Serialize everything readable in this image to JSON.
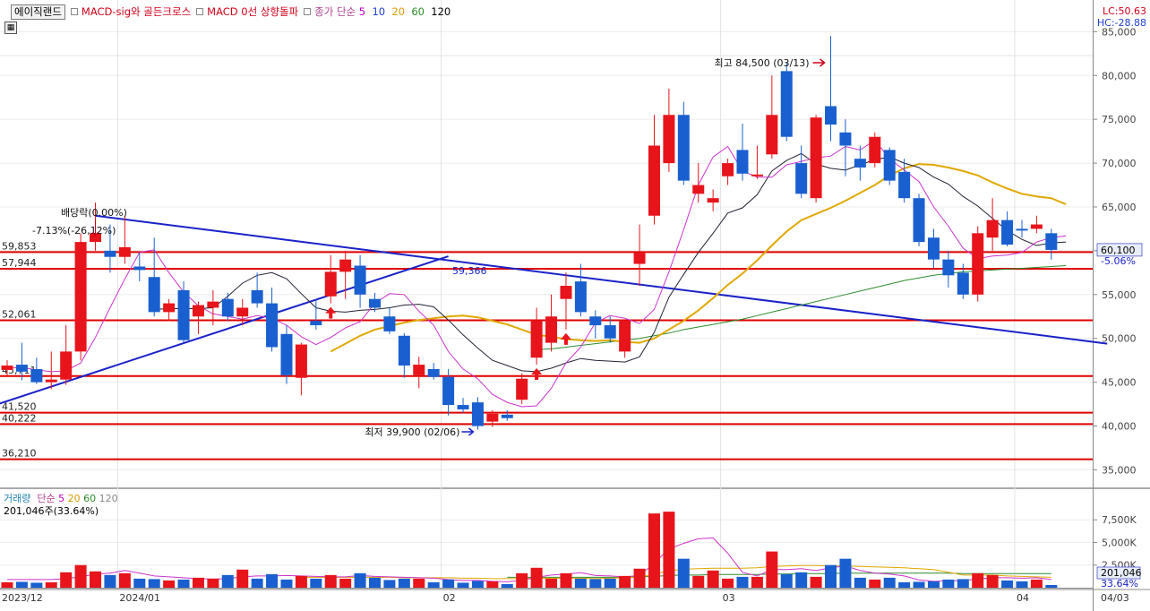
{
  "header": {
    "stock_name": "에이직랜드",
    "ind1": "MACD-sig와 골든크로스",
    "ind2": "MACD 0선 상향돌파",
    "ma_label": "종가 단순",
    "ma_periods": [
      "5",
      "10",
      "20",
      "60",
      "120"
    ],
    "lc": "LC:50.63",
    "hc": "HC:-28.88"
  },
  "volume_header": {
    "label": "거래량",
    "ma_label": "단순",
    "ma_periods": [
      "5",
      "20",
      "60",
      "120"
    ],
    "value_text": "201,046주(33.64%)"
  },
  "colors": {
    "up": "#e8141b",
    "down": "#1a5fd0",
    "ma5": "#cc33cc",
    "ma10": "#222233",
    "ma20": "#e0a800",
    "ma60": "#2e8b2e",
    "hline": "#e00000",
    "trend": "#1a22c8"
  },
  "chart_data": {
    "type": "candlestick",
    "y_axis": {
      "ylim": [
        33000,
        88000
      ],
      "ticks": [
        "85,000",
        "80,000",
        "75,000",
        "70,000",
        "65,000",
        "60,000",
        "55,000",
        "50,000",
        "45,000",
        "40,000",
        "35,000"
      ],
      "tick_values": [
        85000,
        80000,
        75000,
        70000,
        65000,
        60000,
        55000,
        50000,
        45000,
        40000,
        35000
      ]
    },
    "x_axis": {
      "labels": [
        {
          "text": "2023/12",
          "index": 0
        },
        {
          "text": "2024/01",
          "index": 8
        },
        {
          "text": "02",
          "index": 30
        },
        {
          "text": "03",
          "index": 49
        },
        {
          "text": "04",
          "index": 69
        },
        {
          "text": "04/03",
          "index": 74
        }
      ]
    },
    "candles": [
      {
        "o": 46400,
        "h": 47500,
        "l": 45600,
        "c": 46900
      },
      {
        "o": 47000,
        "h": 49500,
        "l": 45200,
        "c": 46200
      },
      {
        "o": 46500,
        "h": 47800,
        "l": 44800,
        "c": 45000
      },
      {
        "o": 45000,
        "h": 48500,
        "l": 44200,
        "c": 45300
      },
      {
        "o": 45300,
        "h": 51500,
        "l": 44700,
        "c": 48500
      },
      {
        "o": 48500,
        "h": 62000,
        "l": 47500,
        "c": 61000
      },
      {
        "o": 61000,
        "h": 65500,
        "l": 60000,
        "c": 62000
      },
      {
        "o": 60000,
        "h": 63000,
        "l": 57500,
        "c": 59300
      },
      {
        "o": 59300,
        "h": 64000,
        "l": 58500,
        "c": 60400
      },
      {
        "o": 58200,
        "h": 59800,
        "l": 56500,
        "c": 57800
      },
      {
        "o": 57000,
        "h": 61500,
        "l": 52500,
        "c": 53000
      },
      {
        "o": 53000,
        "h": 54500,
        "l": 52000,
        "c": 54000
      },
      {
        "o": 55500,
        "h": 56500,
        "l": 49500,
        "c": 49800
      },
      {
        "o": 52500,
        "h": 54200,
        "l": 50500,
        "c": 53800
      },
      {
        "o": 53500,
        "h": 55500,
        "l": 51500,
        "c": 54200
      },
      {
        "o": 54500,
        "h": 55200,
        "l": 52000,
        "c": 52500
      },
      {
        "o": 52500,
        "h": 54500,
        "l": 51500,
        "c": 53500
      },
      {
        "o": 55500,
        "h": 57500,
        "l": 53500,
        "c": 54000
      },
      {
        "o": 54000,
        "h": 55800,
        "l": 48500,
        "c": 49000
      },
      {
        "o": 50500,
        "h": 51500,
        "l": 44800,
        "c": 45800
      },
      {
        "o": 45500,
        "h": 49500,
        "l": 43500,
        "c": 49300
      },
      {
        "o": 52000,
        "h": 54500,
        "l": 51000,
        "c": 51500
      },
      {
        "o": 54800,
        "h": 59500,
        "l": 54000,
        "c": 57600
      },
      {
        "o": 57600,
        "h": 60000,
        "l": 54500,
        "c": 59000
      },
      {
        "o": 58300,
        "h": 59500,
        "l": 53500,
        "c": 55000
      },
      {
        "o": 54500,
        "h": 55200,
        "l": 53000,
        "c": 53500
      },
      {
        "o": 52500,
        "h": 53500,
        "l": 50500,
        "c": 50800
      },
      {
        "o": 50300,
        "h": 50600,
        "l": 45500,
        "c": 46900
      },
      {
        "o": 45800,
        "h": 47900,
        "l": 44300,
        "c": 47000
      },
      {
        "o": 46500,
        "h": 47200,
        "l": 45300,
        "c": 45600
      },
      {
        "o": 45600,
        "h": 46500,
        "l": 41200,
        "c": 42400
      },
      {
        "o": 42400,
        "h": 43200,
        "l": 41500,
        "c": 41900
      },
      {
        "o": 42700,
        "h": 43300,
        "l": 39600,
        "c": 40000
      },
      {
        "o": 40500,
        "h": 41800,
        "l": 39900,
        "c": 41400
      },
      {
        "o": 41300,
        "h": 41800,
        "l": 40600,
        "c": 40900
      },
      {
        "o": 43000,
        "h": 46000,
        "l": 42500,
        "c": 45400
      },
      {
        "o": 47800,
        "h": 53500,
        "l": 47000,
        "c": 52000
      },
      {
        "o": 49500,
        "h": 55000,
        "l": 48500,
        "c": 52500
      },
      {
        "o": 54500,
        "h": 57500,
        "l": 51000,
        "c": 56000
      },
      {
        "o": 56500,
        "h": 58500,
        "l": 52500,
        "c": 53000
      },
      {
        "o": 52500,
        "h": 53200,
        "l": 50000,
        "c": 51500
      },
      {
        "o": 51500,
        "h": 52500,
        "l": 49500,
        "c": 50000
      },
      {
        "o": 48500,
        "h": 52000,
        "l": 47800,
        "c": 52000
      },
      {
        "o": 58500,
        "h": 63000,
        "l": 56000,
        "c": 59800
      },
      {
        "o": 64000,
        "h": 75500,
        "l": 63000,
        "c": 72000
      },
      {
        "o": 70000,
        "h": 78500,
        "l": 69000,
        "c": 75500
      },
      {
        "o": 75500,
        "h": 77000,
        "l": 67500,
        "c": 68000
      },
      {
        "o": 66500,
        "h": 70000,
        "l": 65500,
        "c": 67500
      },
      {
        "o": 65500,
        "h": 67000,
        "l": 64500,
        "c": 66000
      },
      {
        "o": 68500,
        "h": 70500,
        "l": 67500,
        "c": 70000
      },
      {
        "o": 71500,
        "h": 74500,
        "l": 68000,
        "c": 68800
      },
      {
        "o": 68500,
        "h": 72000,
        "l": 68200,
        "c": 68700
      },
      {
        "o": 71000,
        "h": 80000,
        "l": 70500,
        "c": 75500
      },
      {
        "o": 80500,
        "h": 81500,
        "l": 72500,
        "c": 73000
      },
      {
        "o": 70000,
        "h": 72000,
        "l": 66000,
        "c": 66500
      },
      {
        "o": 66000,
        "h": 75500,
        "l": 65500,
        "c": 75200
      },
      {
        "o": 76500,
        "h": 84500,
        "l": 72500,
        "c": 74400
      },
      {
        "o": 73500,
        "h": 75000,
        "l": 68500,
        "c": 72000
      },
      {
        "o": 70500,
        "h": 72000,
        "l": 68000,
        "c": 69500
      },
      {
        "o": 70000,
        "h": 73500,
        "l": 69500,
        "c": 73000
      },
      {
        "o": 71500,
        "h": 71800,
        "l": 67500,
        "c": 68000
      },
      {
        "o": 69000,
        "h": 70500,
        "l": 65500,
        "c": 66000
      },
      {
        "o": 66000,
        "h": 66500,
        "l": 60500,
        "c": 61000
      },
      {
        "o": 61500,
        "h": 62500,
        "l": 58000,
        "c": 59000
      },
      {
        "o": 59000,
        "h": 60000,
        "l": 55800,
        "c": 57200
      },
      {
        "o": 57500,
        "h": 58500,
        "l": 54500,
        "c": 55000
      },
      {
        "o": 55000,
        "h": 62800,
        "l": 54200,
        "c": 62000
      },
      {
        "o": 61500,
        "h": 66000,
        "l": 60000,
        "c": 63500
      },
      {
        "o": 63500,
        "h": 64500,
        "l": 60500,
        "c": 60700
      },
      {
        "o": 62500,
        "h": 63500,
        "l": 61500,
        "c": 62300
      },
      {
        "o": 62500,
        "h": 64000,
        "l": 62000,
        "c": 63000
      },
      {
        "o": 62000,
        "h": 62500,
        "l": 59000,
        "c": 60100
      }
    ],
    "ma5": [
      46600,
      46700,
      46400,
      46200,
      46300,
      47200,
      50100,
      53500,
      56800,
      59800,
      60100,
      57500,
      55300,
      53700,
      52800,
      52500,
      52200,
      52600,
      52300,
      51500,
      50200,
      49300,
      50100,
      51200,
      51900,
      54000,
      55100,
      55000,
      53100,
      51500,
      48500,
      46500,
      45400,
      43600,
      42700,
      42200,
      42300,
      44300,
      47200,
      49000,
      51800,
      52600,
      52300,
      51700,
      53300,
      57600,
      62400,
      67500,
      70700,
      71900,
      69100,
      68400,
      68400,
      69800,
      70200,
      70600,
      70800,
      71900,
      71500,
      72600,
      70500,
      69200,
      67900,
      65000,
      62800,
      60300,
      59100,
      59400,
      59500,
      59800,
      61000,
      61500,
      61700
    ],
    "ma10": [
      null,
      null,
      null,
      null,
      null,
      null,
      null,
      null,
      null,
      null,
      53300,
      53400,
      53400,
      53400,
      53500,
      54800,
      56300,
      57200,
      57500,
      56800,
      55100,
      53500,
      53100,
      53000,
      53200,
      53300,
      53500,
      53800,
      53900,
      53600,
      52100,
      50400,
      48900,
      47500,
      46900,
      46300,
      46200,
      46600,
      47200,
      47700,
      47500,
      47400,
      47300,
      47900,
      50700,
      54700,
      57300,
      59800,
      62000,
      64300,
      64900,
      66400,
      69100,
      70300,
      71100,
      69900,
      69400,
      69200,
      69800,
      70400,
      70700,
      70000,
      69500,
      68400,
      67600,
      66200,
      65100,
      63700,
      62300,
      61300,
      60600,
      60900,
      61000
    ],
    "ma20": [
      null,
      null,
      null,
      null,
      null,
      null,
      null,
      null,
      null,
      null,
      null,
      null,
      null,
      null,
      null,
      null,
      null,
      null,
      null,
      null,
      null,
      null,
      48500,
      49400,
      50300,
      51000,
      51400,
      51800,
      52100,
      52300,
      52500,
      52600,
      52400,
      52000,
      51600,
      51000,
      50400,
      50200,
      49900,
      49800,
      49700,
      49800,
      49600,
      49500,
      50000,
      51000,
      52000,
      53200,
      54600,
      56100,
      57400,
      58900,
      60600,
      62200,
      63500,
      64200,
      64900,
      65700,
      66600,
      67500,
      68600,
      69400,
      69900,
      69800,
      69500,
      69100,
      68600,
      67800,
      67100,
      66500,
      66200,
      66000,
      65300
    ],
    "ma60": [
      null,
      null,
      null,
      null,
      null,
      null,
      null,
      null,
      null,
      null,
      null,
      null,
      null,
      null,
      null,
      null,
      null,
      null,
      null,
      null,
      null,
      null,
      null,
      null,
      null,
      null,
      null,
      null,
      null,
      null,
      null,
      null,
      null,
      null,
      null,
      null,
      48700,
      48800,
      49000,
      49200,
      49400,
      49600,
      49800,
      50000,
      50300,
      50600,
      51000,
      51300,
      51600,
      51900,
      52200,
      52600,
      53000,
      53400,
      53800,
      54200,
      54600,
      55000,
      55400,
      55800,
      56200,
      56600,
      56900,
      57200,
      57400,
      57600,
      57700,
      57800,
      57900,
      58000,
      58100,
      58200,
      58300
    ],
    "hlines": [
      {
        "value": 59853,
        "label": "59,853"
      },
      {
        "value": 57944,
        "label": "57,944"
      },
      {
        "value": 52061,
        "label": "52,061"
      },
      {
        "value": 45700,
        "label": "45,711"
      },
      {
        "value": 41520,
        "label": "41,520"
      },
      {
        "value": 40222,
        "label": "40,222"
      },
      {
        "value": 36210,
        "label": "36,210"
      }
    ],
    "trendlines": [
      {
        "from": {
          "index": -1,
          "value": 42300
        },
        "to": {
          "index": 30,
          "value": 59366
        }
      },
      {
        "from": {
          "index": 6,
          "value": 64000
        },
        "to": {
          "index": 74.8,
          "value": 49400
        }
      }
    ],
    "annotations": {
      "dividend": "배당락(0.00%)",
      "dividend_change": "-7.13%(-26,12%)",
      "trend_value": "59,366",
      "high": "최고 84,500 (03/13)",
      "low": "최저 39,900 (02/06)",
      "current_price": "60,100",
      "current_change": "-5.06%"
    },
    "signals": [
      22,
      36,
      38
    ],
    "volume": {
      "ylim": [
        0,
        9500
      ],
      "ticks": [
        "7,500K",
        "5,000K",
        "2,500K"
      ],
      "tick_values": [
        7500,
        5000,
        2500
      ],
      "current_label": "201,046",
      "current_pct": "33.64%",
      "bars": [
        600,
        650,
        550,
        600,
        1700,
        2500,
        1800,
        1400,
        1600,
        1000,
        950,
        800,
        900,
        1100,
        1000,
        1400,
        2000,
        1000,
        1500,
        900,
        1300,
        1000,
        1400,
        1000,
        1600,
        1100,
        850,
        1000,
        1000,
        600,
        900,
        550,
        750,
        700,
        400,
        1600,
        2200,
        1000,
        1600,
        1000,
        950,
        1000,
        1300,
        2100,
        8200,
        8400,
        3200,
        1300,
        1900,
        1000,
        1200,
        1200,
        4000,
        1500,
        1700,
        1200,
        2500,
        3200,
        1100,
        900,
        1100,
        600,
        650,
        700,
        900,
        950,
        1600,
        1400,
        800,
        700,
        900,
        300
      ],
      "ma5": [
        900,
        900,
        900,
        900,
        1000,
        1200,
        1500,
        1600,
        1900,
        1600,
        1300,
        1200,
        1100,
        1000,
        950,
        1000,
        1200,
        1300,
        1300,
        1350,
        1300,
        1250,
        1200,
        1200,
        1350,
        1250,
        1200,
        1150,
        1100,
        1050,
        900,
        800,
        800,
        700,
        650,
        800,
        1150,
        1400,
        1500,
        1650,
        1350,
        1300,
        1200,
        1350,
        2700,
        4300,
        4900,
        5400,
        5500,
        3800,
        1700,
        1300,
        2000,
        2000,
        2100,
        1900,
        2200,
        2400,
        1900,
        1600,
        1500,
        1300,
        850,
        700,
        750,
        800,
        950,
        1100,
        1100,
        1050,
        1100,
        900
      ],
      "ma20": [
        null,
        null,
        null,
        null,
        null,
        null,
        null,
        null,
        null,
        null,
        null,
        null,
        null,
        null,
        null,
        null,
        null,
        null,
        null,
        null,
        1150,
        1150,
        1150,
        1150,
        1150,
        1150,
        1150,
        1100,
        1100,
        1100,
        1100,
        1050,
        1050,
        1000,
        1000,
        1000,
        1050,
        1050,
        1050,
        1050,
        1000,
        1050,
        1100,
        1150,
        1500,
        1850,
        2050,
        2100,
        2150,
        2150,
        2150,
        2200,
        2350,
        2400,
        2450,
        2450,
        2400,
        2400,
        2350,
        2300,
        2250,
        2200,
        2100,
        2000,
        1700,
        1400,
        1400,
        1400,
        1300,
        1250,
        1200,
        1150
      ],
      "ma60": [
        null,
        null,
        null,
        null,
        null,
        null,
        null,
        null,
        null,
        null,
        null,
        null,
        null,
        null,
        null,
        null,
        null,
        null,
        null,
        null,
        null,
        null,
        null,
        null,
        null,
        null,
        null,
        null,
        null,
        null,
        null,
        null,
        null,
        null,
        1150,
        1150,
        1150,
        1150,
        1150,
        1150,
        1150,
        1150,
        1150,
        1200,
        1250,
        1350,
        1400,
        1400,
        1450,
        1450,
        1450,
        1450,
        1500,
        1500,
        1550,
        1550,
        1550,
        1600,
        1600,
        1600,
        1600,
        1600,
        1600,
        1600,
        1600,
        1550,
        1550,
        1550,
        1550,
        1550,
        1550,
        1550
      ]
    }
  }
}
